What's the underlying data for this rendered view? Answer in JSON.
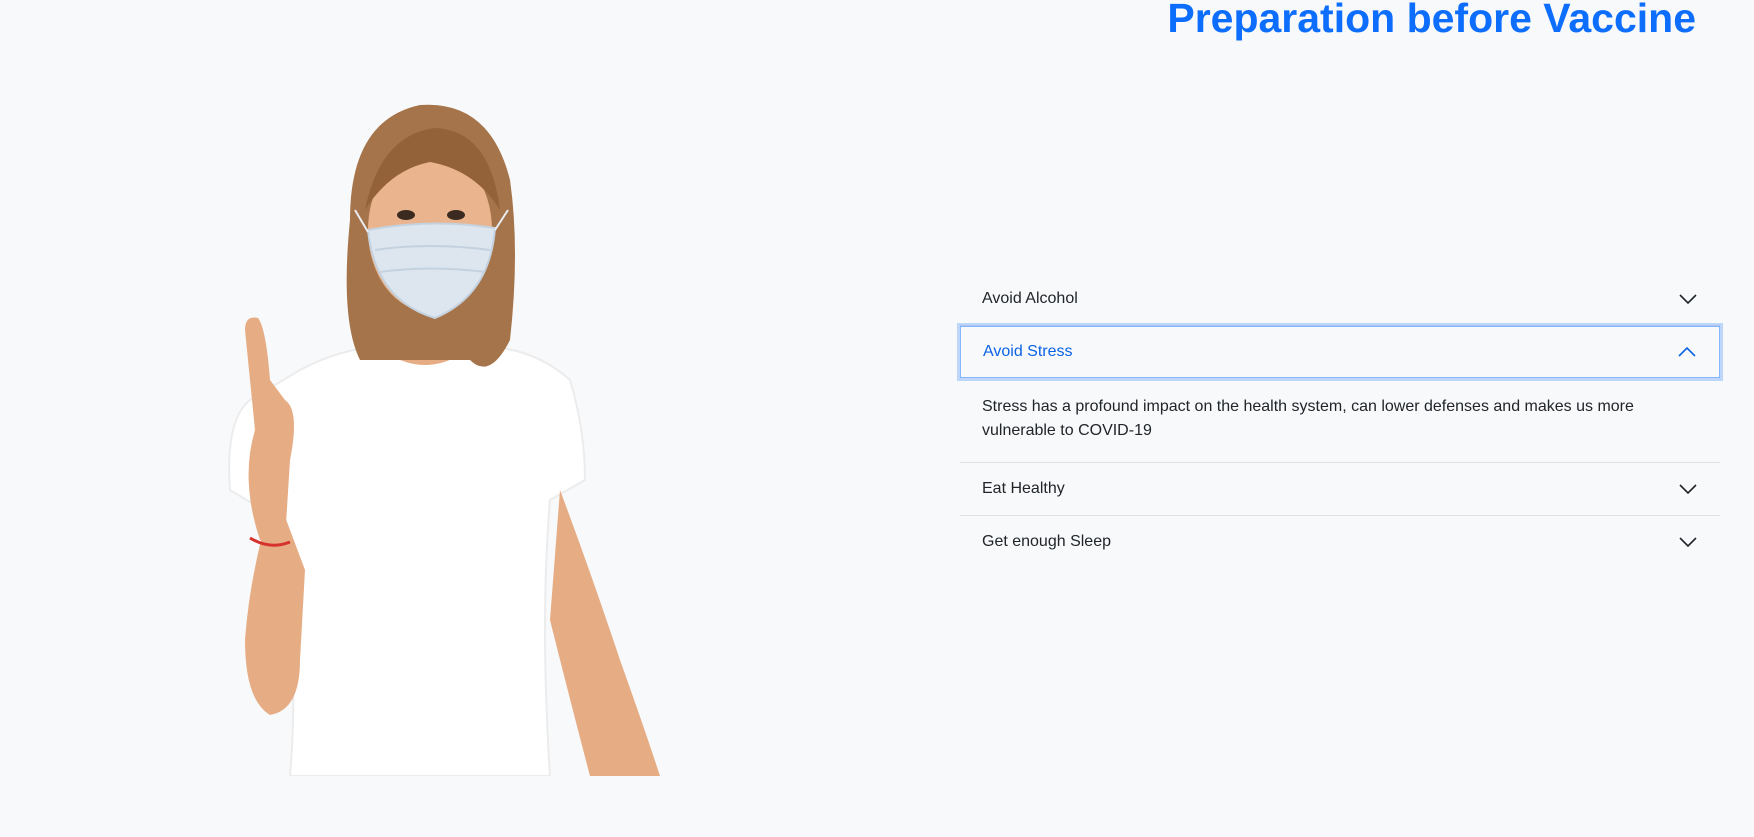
{
  "heading": "Preparation before Vaccine",
  "illustration": {
    "icon": "woman-in-mask-raising-finger-illustration"
  },
  "colors": {
    "accent": "#0d6efd",
    "active_header": "#0c63e4",
    "background": "#f8f9fa",
    "text": "#212529",
    "divider": "#dee2e6"
  },
  "accordion": {
    "items": [
      {
        "title": "Avoid Alcohol",
        "expanded": false
      },
      {
        "title": "Avoid Stress",
        "expanded": true,
        "body": "Stress has a profound impact on the health system, can lower defenses and makes us more vulnerable to COVID-19"
      },
      {
        "title": "Eat Healthy",
        "expanded": false
      },
      {
        "title": "Get enough Sleep",
        "expanded": false
      }
    ]
  }
}
